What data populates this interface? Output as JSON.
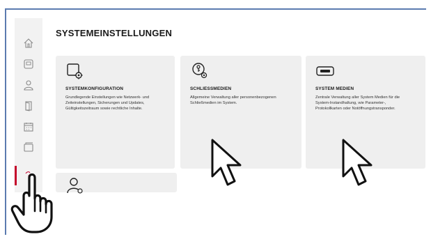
{
  "page": {
    "title": "SYSTEMEINSTELLUNGEN"
  },
  "sidebar": {
    "items": [
      {
        "icon": "home-icon"
      },
      {
        "icon": "dashboard-icon"
      },
      {
        "icon": "user-icon"
      },
      {
        "icon": "door-icon"
      },
      {
        "icon": "calendar-icon"
      },
      {
        "icon": "window-icon"
      },
      {
        "icon": "settings-icon",
        "active": true
      }
    ]
  },
  "cards": [
    {
      "icon": "system-config-icon",
      "title": "SYSTEMKONFIGURATION",
      "description": "Grundlegende Einstellungen wie Netzwerk- und Zeiteinstellungen, Sicherungen und Updates, Gültigkeitszeitraum sowie rechtliche Inhalte."
    },
    {
      "icon": "key-settings-icon",
      "title": "SCHLIESSMEDIEN",
      "description": "Allgemeine Verwaltung aller personenbezogenen Schließmedien im System."
    },
    {
      "icon": "card-medium-icon",
      "title": "SYSTEM MEDIEN",
      "description": "Zentrale Verwaltung aller System Medien für die System-Instandhaltung, wie Parameter-, Protokollkarten oder Notöffnungstransponder."
    },
    {
      "icon": "user-settings-icon",
      "title": "",
      "description": ""
    }
  ],
  "overlays": {
    "pointer_cursors": 2,
    "hand_cursor": "hand-pointer-icon"
  }
}
